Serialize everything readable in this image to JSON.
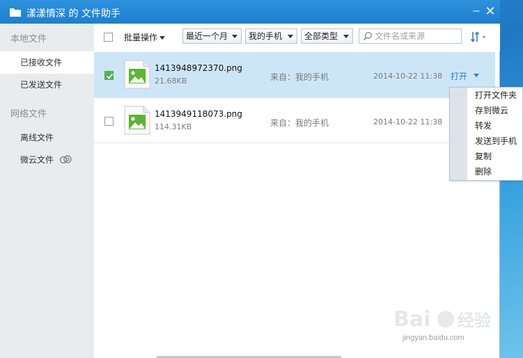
{
  "window": {
    "title": "漾漾情深 的 文件助手",
    "minimize_label": "–",
    "close_label": "✕"
  },
  "sidebar": {
    "sections": [
      {
        "label": "本地文件",
        "items": [
          "已接收文件",
          "已发送文件"
        ]
      },
      {
        "label": "网络文件",
        "items": [
          "离线文件",
          "微云文件"
        ]
      }
    ],
    "active_item": "已接收文件"
  },
  "toolbar": {
    "batch_label": "批量操作",
    "filters": {
      "time": "最近一个月",
      "device": "我的手机",
      "type": "全部类型"
    },
    "search_placeholder": "文件名或来源",
    "sort_icon": "sort-icon"
  },
  "files": [
    {
      "name": "1413948972370.png",
      "size": "21.68KB",
      "source": "来自：我的手机",
      "time": "2014-10-22 11:38",
      "action": "打开",
      "checked": true
    },
    {
      "name": "1413949118073.png",
      "size": "114.31KB",
      "source": "来自：我的手机",
      "time": "2014-10-22 11:38",
      "action": "",
      "checked": false
    }
  ],
  "context_menu": [
    "打开文件夹",
    "存到微云",
    "转发",
    "发送到手机",
    "复制",
    "删除"
  ],
  "watermark": {
    "logo": "Bai 经验",
    "url": "jingyan.baidu.com"
  },
  "colors": {
    "title_bar": "#1d7fd0",
    "selected_row": "#cde6f7",
    "sidebar": "#e9ecef",
    "link": "#1e7ed2",
    "check": "#4fb24a"
  }
}
